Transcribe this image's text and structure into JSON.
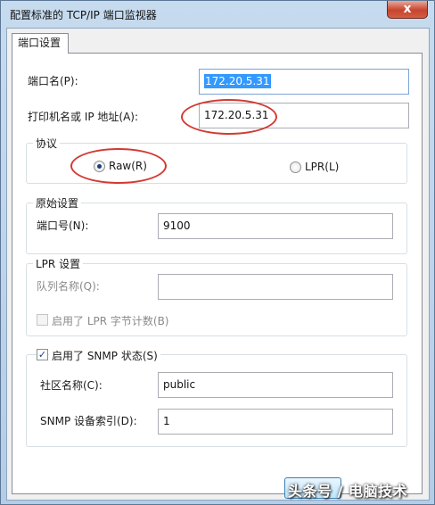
{
  "window": {
    "title": "配置标准的 TCP/IP 端口监视器",
    "close_glyph": "x"
  },
  "tabs": [
    {
      "label": "端口设置",
      "active": true
    }
  ],
  "port_name": {
    "label": "端口名(P):",
    "value": "172.20.5.31"
  },
  "printer_address": {
    "label": "打印机名或 IP 地址(A):",
    "value": "172.20.5.31"
  },
  "protocol": {
    "title": "协议",
    "options": [
      {
        "label": "Raw(R)",
        "checked": true
      },
      {
        "label": "LPR(L)",
        "checked": false
      }
    ]
  },
  "raw_settings": {
    "title": "原始设置",
    "port_number_label": "端口号(N):",
    "port_number_value": "9100"
  },
  "lpr_settings": {
    "title": "LPR 设置",
    "queue_name_label": "队列名称(Q):",
    "queue_name_value": "",
    "byte_counting_label": "启用了 LPR 字节计数(B)",
    "byte_counting_checked": false
  },
  "snmp": {
    "title": "启用了 SNMP 状态(S)",
    "enabled": true,
    "community_label": "社区名称(C):",
    "community_value": "public",
    "device_index_label": "SNMP 设备索引(D):",
    "device_index_value": "1"
  },
  "watermark": "头条号 / 电脑技术",
  "colors": {
    "annotation_red": "#d23a32",
    "selection_blue": "#3399ff"
  }
}
